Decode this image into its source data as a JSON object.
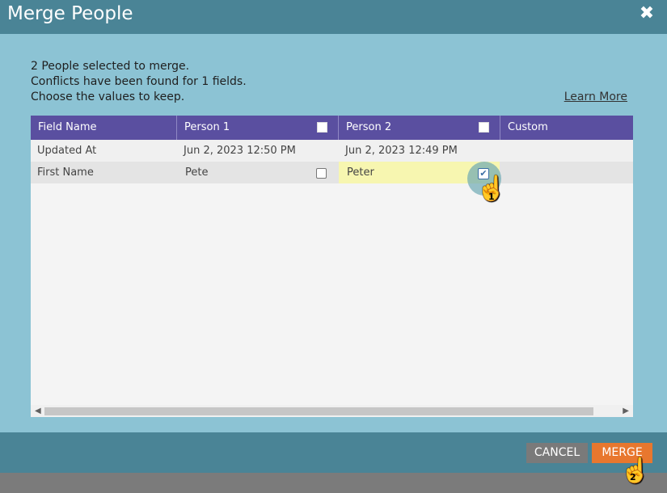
{
  "dialog": {
    "title": "Merge People",
    "messages": [
      "2 People selected to merge.",
      "Conflicts have been found for 1 fields.",
      "Choose the values to keep."
    ],
    "learn_more": "Learn More"
  },
  "grid": {
    "columns": [
      "Field Name",
      "Person 1",
      "Person 2",
      "Custom"
    ],
    "rows": [
      {
        "field": "Updated At",
        "p1": "Jun 2, 2023 12:50 PM",
        "p2": "Jun 2, 2023 12:49 PM",
        "custom": ""
      },
      {
        "field": "First Name",
        "p1": "Pete",
        "p2": "Peter",
        "custom": "",
        "p1_checked": false,
        "p2_checked": true
      }
    ]
  },
  "cursors": [
    {
      "label": "1"
    },
    {
      "label": "2"
    }
  ],
  "buttons": {
    "cancel": "CANCEL",
    "merge": "MERGE"
  },
  "colors": {
    "header_bg": "#4a8496",
    "dialog_bg": "#8cc3d4",
    "grid_header": "#5a4fa0",
    "merge_button": "#e8772e",
    "cancel_button": "#7a7a7a",
    "selected_cell": "#f7f6b0"
  }
}
